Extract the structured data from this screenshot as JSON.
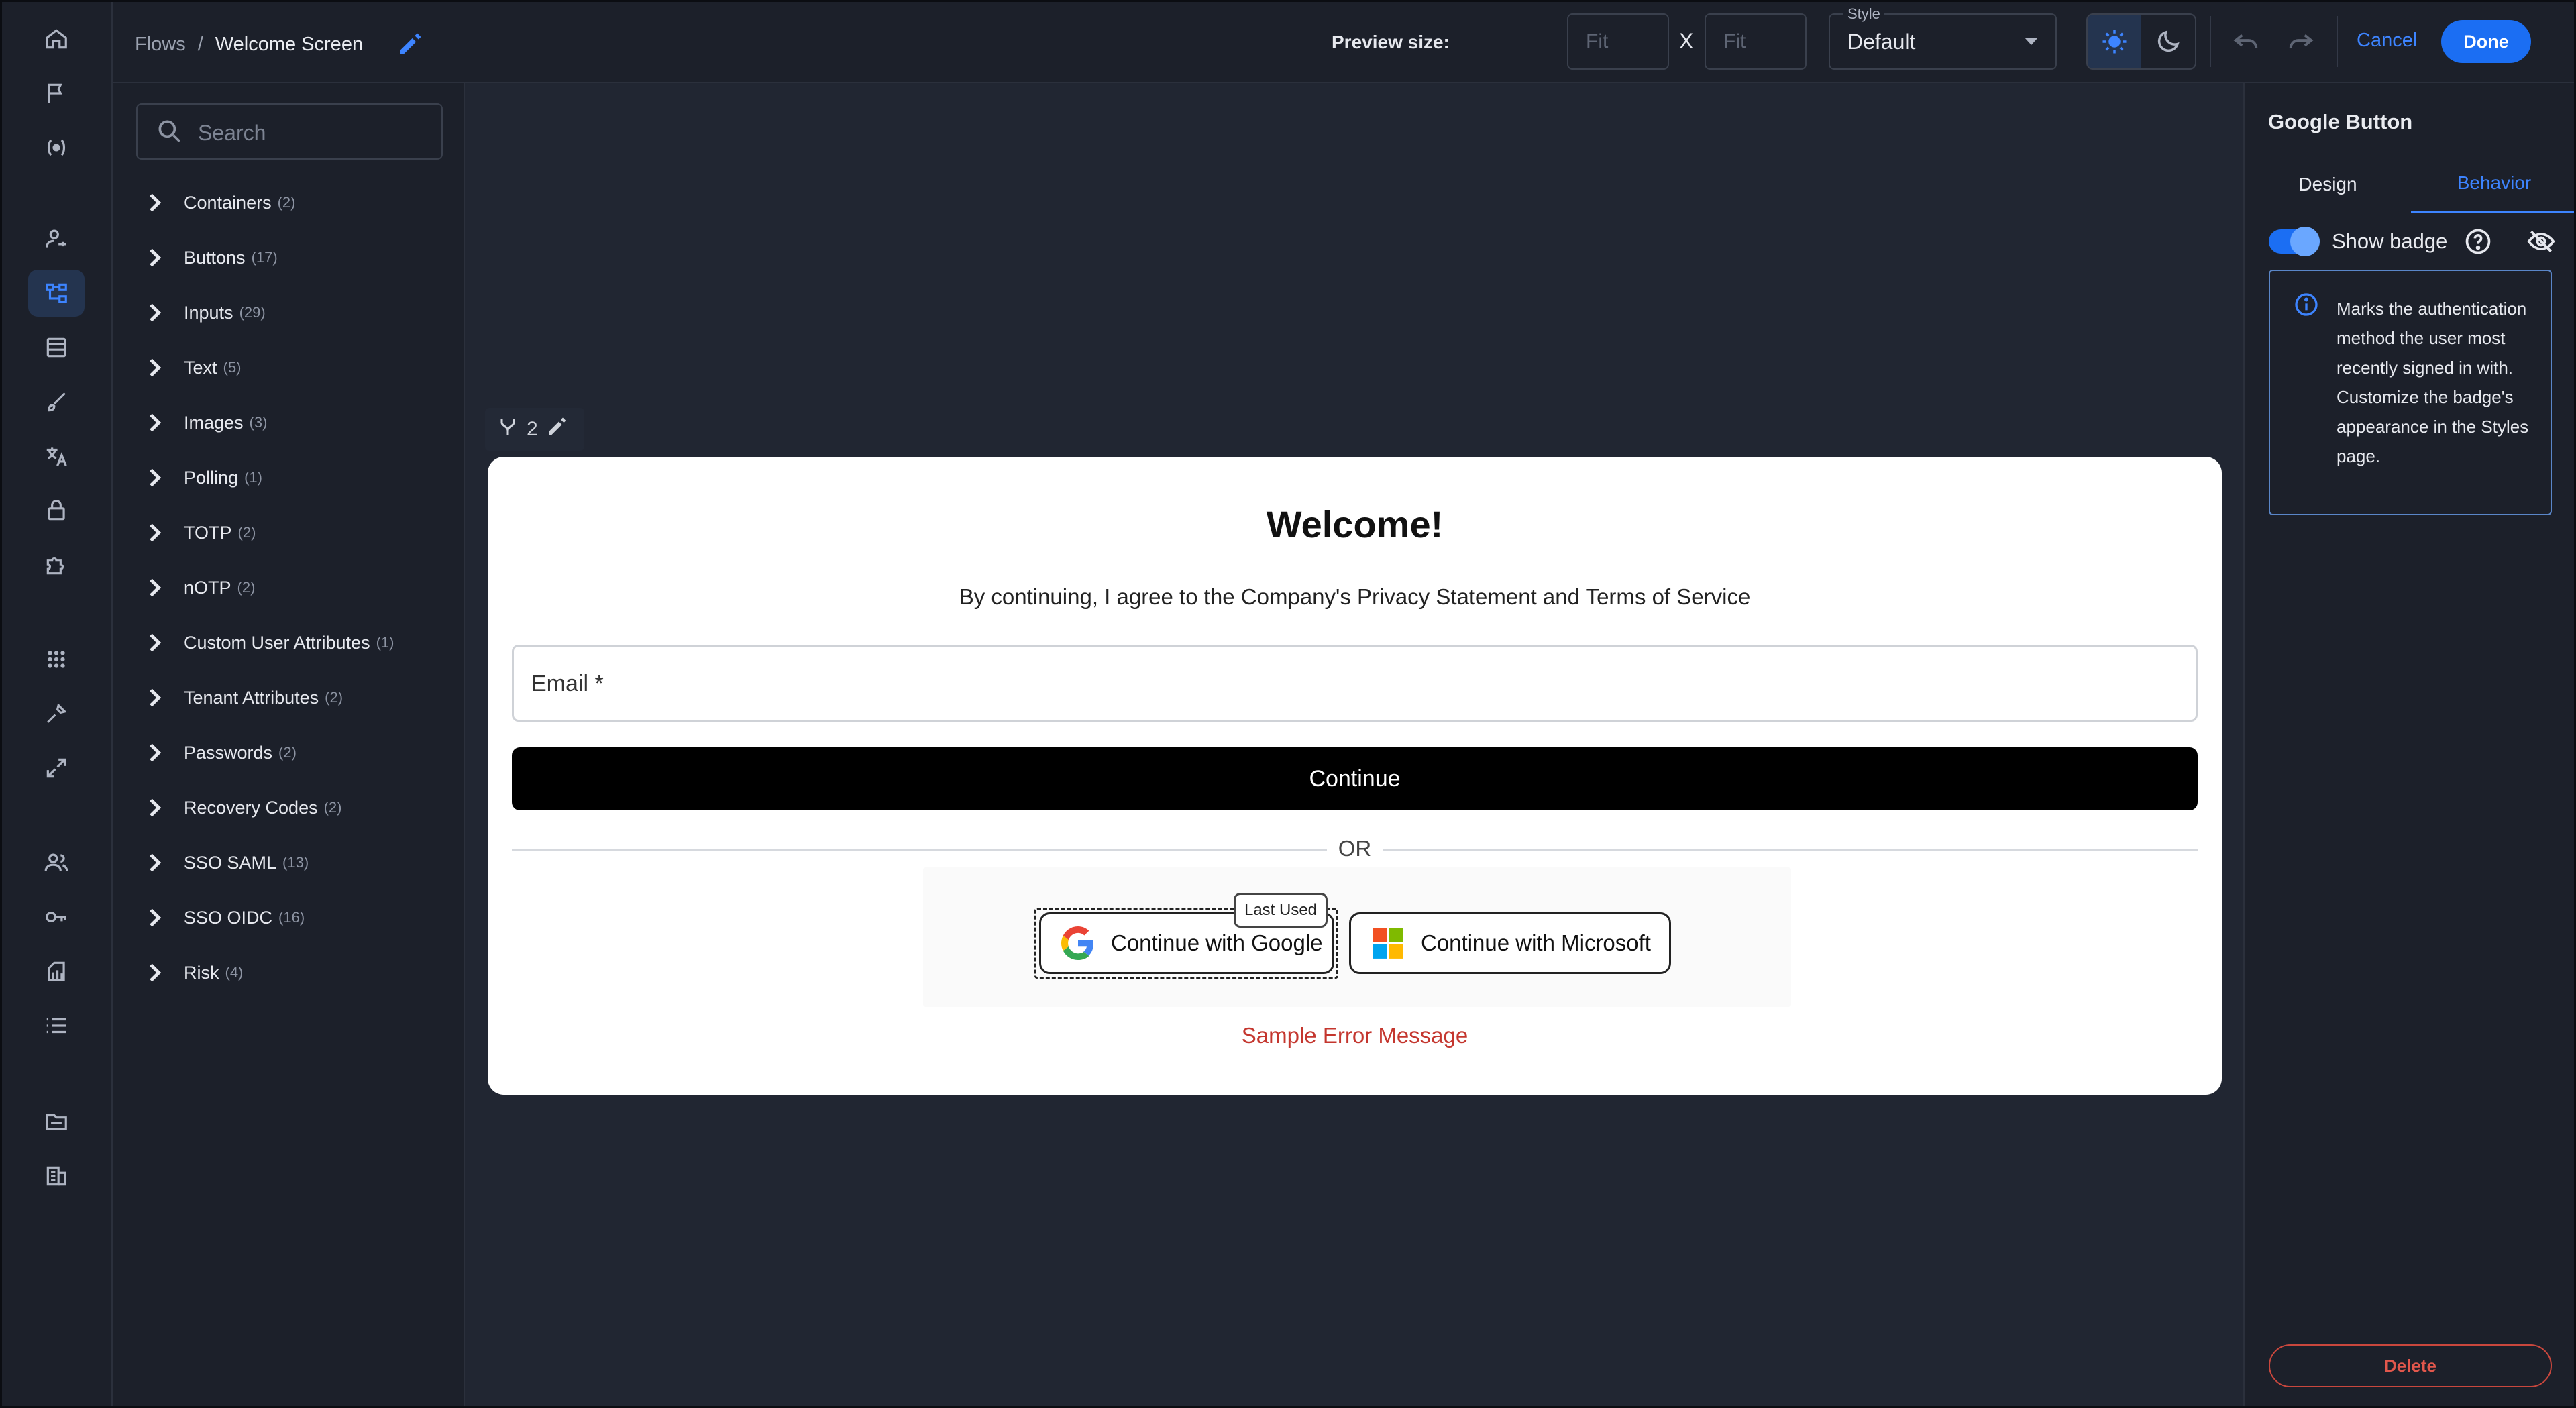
{
  "breadcrumb": {
    "root": "Flows",
    "separator": "/",
    "current": "Welcome Screen"
  },
  "toolbar": {
    "preview_label": "Preview size:",
    "width_placeholder": "Fit",
    "height_placeholder": "Fit",
    "times": "X",
    "style_legend": "Style",
    "style_value": "Default",
    "theme_active": "light",
    "cancel_label": "Cancel",
    "done_label": "Done"
  },
  "rail_icons": [
    "home-icon",
    "flag-icon",
    "connectors-icon",
    "user-key-icon",
    "flows-icon",
    "table-icon",
    "brush-icon",
    "translate-icon",
    "lock-icon",
    "puzzle-icon",
    "apps-grid-icon",
    "tools-icon",
    "expand-icon",
    "users-icon",
    "keys-icon",
    "audit-icon",
    "list-icon",
    "folder-icon",
    "building-icon"
  ],
  "search": {
    "placeholder": "Search"
  },
  "categories": [
    {
      "label": "Containers",
      "count": "(2)"
    },
    {
      "label": "Buttons",
      "count": "(17)"
    },
    {
      "label": "Inputs",
      "count": "(29)"
    },
    {
      "label": "Text",
      "count": "(5)"
    },
    {
      "label": "Images",
      "count": "(3)"
    },
    {
      "label": "Polling",
      "count": "(1)"
    },
    {
      "label": "TOTP",
      "count": "(2)"
    },
    {
      "label": "nOTP",
      "count": "(2)"
    },
    {
      "label": "Custom User Attributes",
      "count": "(1)"
    },
    {
      "label": "Tenant Attributes",
      "count": "(2)"
    },
    {
      "label": "Passwords",
      "count": "(2)"
    },
    {
      "label": "Recovery Codes",
      "count": "(2)"
    },
    {
      "label": "SSO SAML",
      "count": "(13)"
    },
    {
      "label": "SSO OIDC",
      "count": "(16)"
    },
    {
      "label": "Risk",
      "count": "(4)"
    }
  ],
  "node_toolbar": {
    "branch_count": "2"
  },
  "screen": {
    "title": "Welcome!",
    "agreement": "By continuing, I agree to the Company's Privacy Statement and Terms of Service",
    "email_label": "Email *",
    "continue_label": "Continue",
    "divider_text": "OR",
    "google_label": "Continue with Google",
    "microsoft_label": "Continue with Microsoft",
    "badge_text": "Last Used",
    "error_message": "Sample Error Message"
  },
  "properties": {
    "title": "Google Button",
    "tabs": [
      "Design",
      "Behavior"
    ],
    "active_tab": "Behavior",
    "show_badge_label": "Show badge",
    "show_badge_enabled": true,
    "info_text": "Marks the authentication method the user most recently signed in with. Customize the badge's appearance in the Styles page.",
    "delete_label": "Delete"
  },
  "colors": {
    "accent": "#3d84ff",
    "primary_button": "#1b6ef3",
    "danger": "#e2574c",
    "error_text": "#c4362e"
  }
}
